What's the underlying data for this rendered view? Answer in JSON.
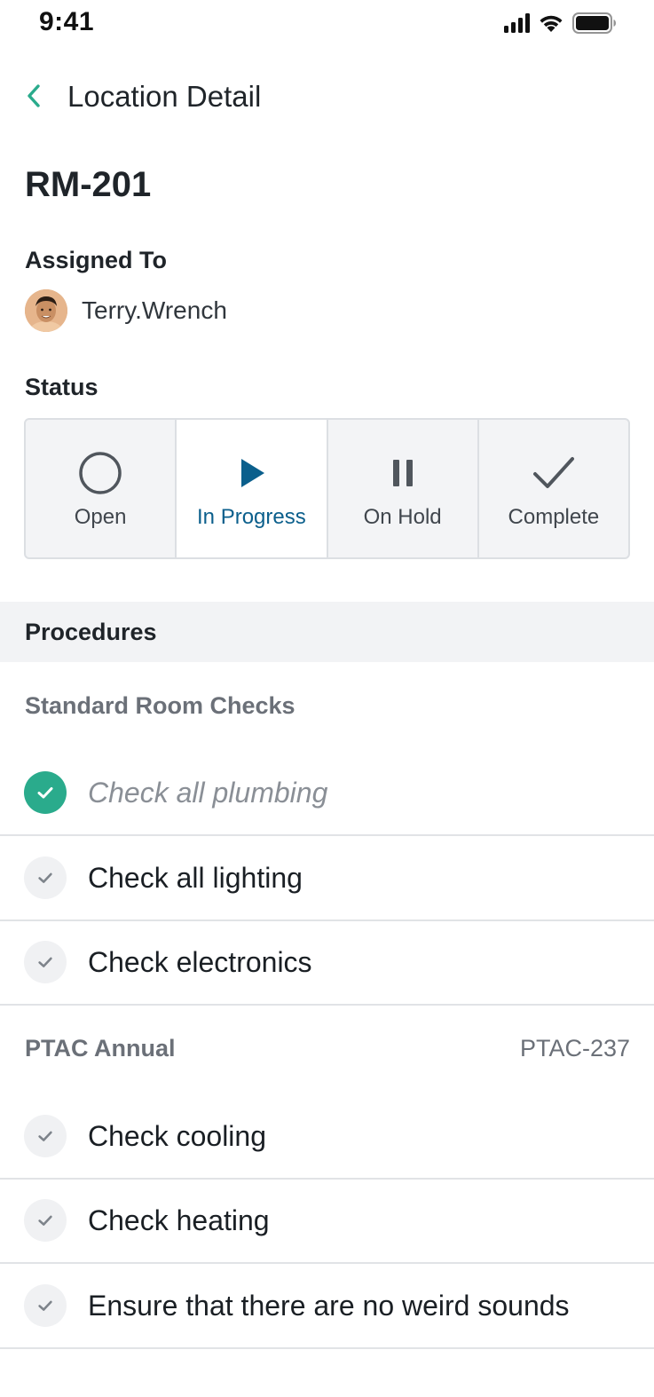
{
  "status_bar": {
    "time": "9:41"
  },
  "nav": {
    "title": "Location Detail"
  },
  "room": {
    "id": "RM-201"
  },
  "assigned": {
    "label": "Assigned To",
    "name": "Terry.Wrench"
  },
  "status": {
    "label": "Status",
    "selected": "In Progress",
    "options": [
      {
        "label": "Open",
        "icon": "circle-icon"
      },
      {
        "label": "In Progress",
        "icon": "play-icon"
      },
      {
        "label": "On Hold",
        "icon": "pause-icon"
      },
      {
        "label": "Complete",
        "icon": "checkmark-icon"
      }
    ],
    "accent_color": "#0b5f8c"
  },
  "procedures": {
    "header": "Procedures",
    "groups": [
      {
        "title": "Standard Room Checks",
        "code": "",
        "tasks": [
          {
            "label": "Check all plumbing",
            "done": true
          },
          {
            "label": "Check all lighting",
            "done": false
          },
          {
            "label": "Check electronics",
            "done": false
          }
        ]
      },
      {
        "title": "PTAC Annual",
        "code": "PTAC-237",
        "tasks": [
          {
            "label": "Check cooling",
            "done": false
          },
          {
            "label": "Check heating",
            "done": false
          },
          {
            "label": "Ensure that there are no weird sounds",
            "done": false
          }
        ]
      }
    ],
    "done_color": "#2aab8c"
  }
}
